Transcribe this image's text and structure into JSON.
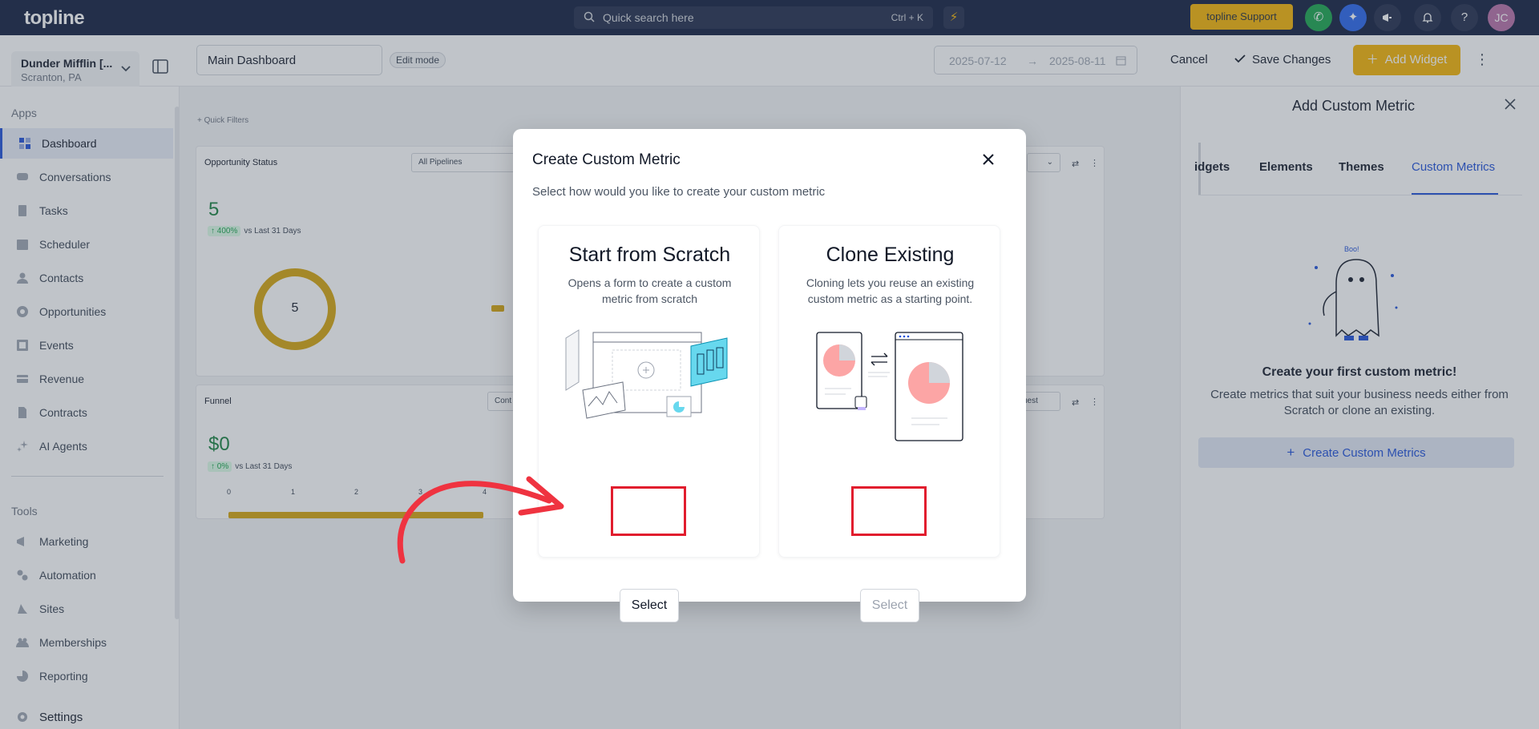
{
  "topbar": {
    "logo": "topline",
    "search_placeholder": "Quick search here",
    "search_shortcut": "Ctrl + K",
    "support_label": "topline Support",
    "avatar_initials": "JC"
  },
  "header": {
    "account_name": "Dunder Mifflin [...",
    "account_location": "Scranton, PA",
    "dashboard_name": "Main Dashboard",
    "edit_mode_badge": "Edit mode",
    "date_start": "2025-07-12",
    "date_end": "2025-08-11",
    "cancel_label": "Cancel",
    "save_label": "Save Changes",
    "add_widget_label": "Add Widget"
  },
  "sidebar": {
    "apps_title": "Apps",
    "apps": [
      {
        "label": "Dashboard",
        "icon": "dashboard-icon"
      },
      {
        "label": "Conversations",
        "icon": "conversations-icon"
      },
      {
        "label": "Tasks",
        "icon": "tasks-icon"
      },
      {
        "label": "Scheduler",
        "icon": "calendar-icon"
      },
      {
        "label": "Contacts",
        "icon": "contacts-icon"
      },
      {
        "label": "Opportunities",
        "icon": "opportunities-icon"
      },
      {
        "label": "Events",
        "icon": "events-icon"
      },
      {
        "label": "Revenue",
        "icon": "revenue-icon"
      },
      {
        "label": "Contracts",
        "icon": "contracts-icon"
      },
      {
        "label": "AI Agents",
        "icon": "ai-agents-icon"
      }
    ],
    "tools_title": "Tools",
    "tools": [
      {
        "label": "Marketing",
        "icon": "megaphone-icon"
      },
      {
        "label": "Automation",
        "icon": "automation-icon"
      },
      {
        "label": "Sites",
        "icon": "sites-icon"
      },
      {
        "label": "Memberships",
        "icon": "memberships-icon"
      },
      {
        "label": "Reporting",
        "icon": "reporting-icon"
      }
    ],
    "settings_label": "Settings"
  },
  "canvas": {
    "quick_filters": "+ Quick Filters",
    "opportunity_card": {
      "title": "Opportunity Status",
      "filter": "All Pipelines",
      "value": "5",
      "change": "↑ 400%",
      "compare": "vs Last 31 Days",
      "donut_value": "5"
    },
    "funnel_card": {
      "title": "Funnel",
      "filter": "Cont",
      "right_filter": "uest",
      "value": "$0",
      "change": "↑ 0%",
      "compare": "vs Last 31 Days",
      "axis_ticks": [
        "0",
        "1",
        "2",
        "3",
        "4"
      ]
    }
  },
  "right_panel": {
    "title": "Add Custom Metric",
    "tabs": [
      "idgets",
      "Elements",
      "Themes",
      "Custom Metrics"
    ],
    "empty_title": "Create your first custom metric!",
    "empty_text": "Create metrics that suit your business needs either from Scratch or clone an existing.",
    "create_button": "Create Custom Metrics"
  },
  "modal": {
    "title": "Create Custom Metric",
    "subtitle": "Select how would you like to create your custom metric",
    "option_scratch": {
      "heading": "Start from Scratch",
      "description": "Opens a form to create a custom metric from scratch",
      "button": "Select"
    },
    "option_clone": {
      "heading": "Clone Existing",
      "description": "Cloning lets you reuse an existing custom metric as a starting point.",
      "button": "Select"
    }
  },
  "colors": {
    "topbar": "#0f1b3d",
    "accent_yellow": "#f5b301",
    "primary_blue": "#1d4ed8",
    "highlight_red": "#e11d2e"
  }
}
